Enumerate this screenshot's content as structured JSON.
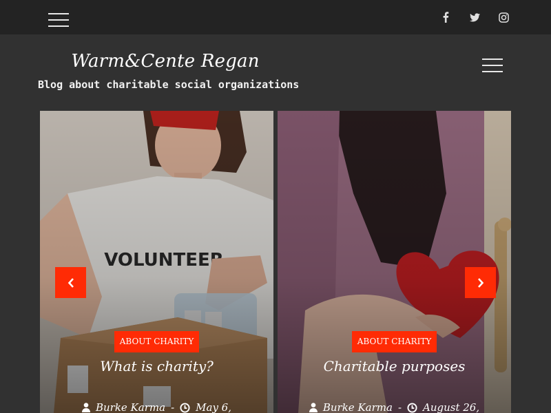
{
  "colors": {
    "accent": "#ff2b05",
    "topbar_bg": "#232323",
    "page_bg": "#313131"
  },
  "topbar": {
    "socials": [
      {
        "icon": "facebook-icon"
      },
      {
        "icon": "twitter-icon"
      },
      {
        "icon": "instagram-icon"
      }
    ]
  },
  "header": {
    "title": "Warm&Cente Regan",
    "tagline": "Blog about charitable social organizations"
  },
  "slider": {
    "slides": [
      {
        "category": "ABOUT CHARITY",
        "title": "What is charity?",
        "author": "Burke Karma",
        "separator": "-",
        "date": "May 6,",
        "photo": "volunteer-with-box"
      },
      {
        "category": "ABOUT CHARITY",
        "title": "Charitable purposes",
        "author": "Burke Karma",
        "separator": "-",
        "date": "August 26,",
        "photo": "hands-holding-red-heart"
      }
    ]
  }
}
